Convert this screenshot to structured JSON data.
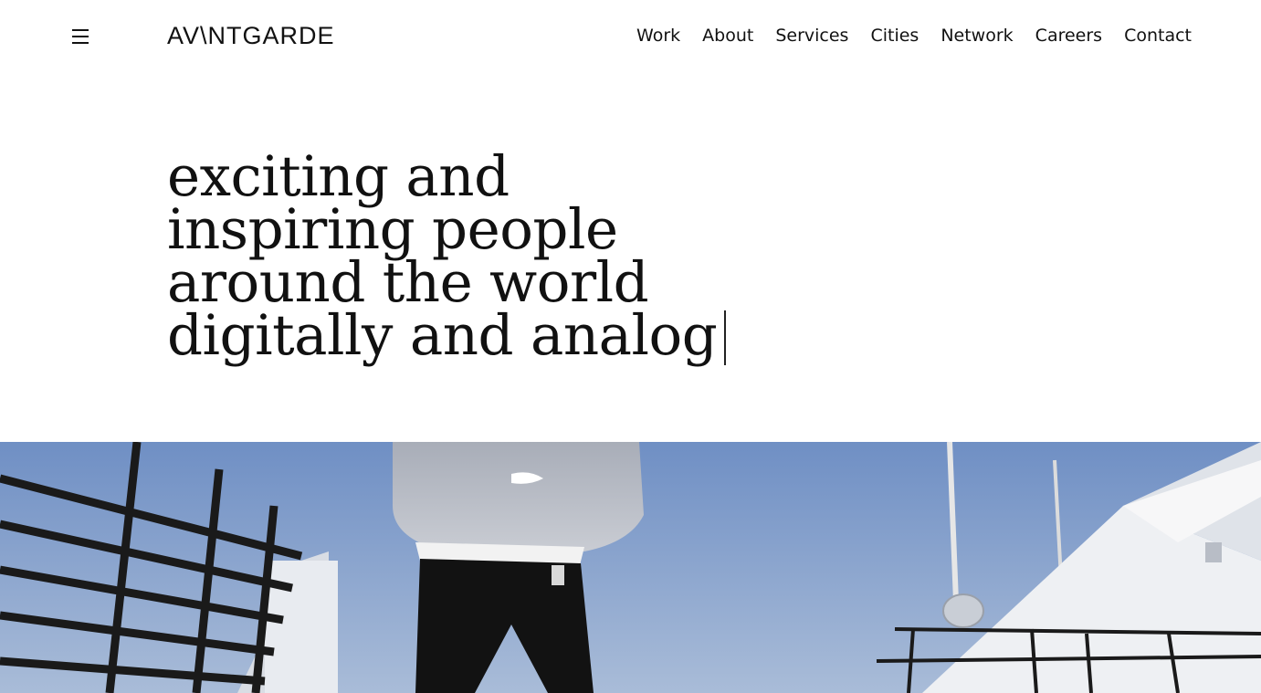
{
  "header": {
    "logo_text": "AV\\NTGARDE",
    "nav": [
      "Work",
      "About",
      "Services",
      "Cities",
      "Network",
      "Careers",
      "Contact"
    ]
  },
  "hero": {
    "headline": "exciting and inspiring people around the world digitally and analog"
  },
  "colors": {
    "text": "#111111",
    "background": "#ffffff",
    "sky": "#7f9cc8"
  },
  "icons": {
    "menu": "hamburger-icon"
  }
}
